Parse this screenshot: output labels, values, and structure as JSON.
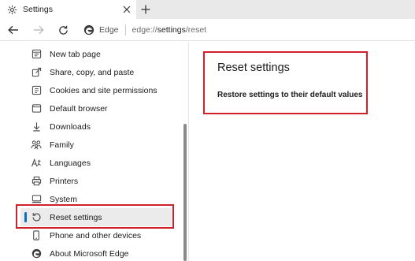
{
  "tab": {
    "title": "Settings",
    "close_glyph": "✕",
    "new_tab_glyph": "+"
  },
  "toolbar": {
    "site_name": "Edge",
    "url_scheme": "edge://",
    "url_path_bold": "settings",
    "url_rest": "/reset"
  },
  "sidebar": {
    "items": [
      {
        "label": "New tab page",
        "icon": "new-tab-icon"
      },
      {
        "label": "Share, copy, and paste",
        "icon": "share-icon"
      },
      {
        "label": "Cookies and site permissions",
        "icon": "cookies-icon"
      },
      {
        "label": "Default browser",
        "icon": "default-browser-icon"
      },
      {
        "label": "Downloads",
        "icon": "download-icon"
      },
      {
        "label": "Family",
        "icon": "family-icon"
      },
      {
        "label": "Languages",
        "icon": "languages-icon"
      },
      {
        "label": "Printers",
        "icon": "printer-icon"
      },
      {
        "label": "System",
        "icon": "system-icon"
      },
      {
        "label": "Reset settings",
        "icon": "reset-icon",
        "active": true
      },
      {
        "label": "Phone and other devices",
        "icon": "phone-icon"
      },
      {
        "label": "About Microsoft Edge",
        "icon": "edge-logo-icon"
      }
    ]
  },
  "main": {
    "title": "Reset settings",
    "option": "Restore settings to their default values"
  },
  "colors": {
    "highlight": "#d0202c",
    "accent": "#0f6cbd",
    "active_bg": "#ebebeb"
  }
}
